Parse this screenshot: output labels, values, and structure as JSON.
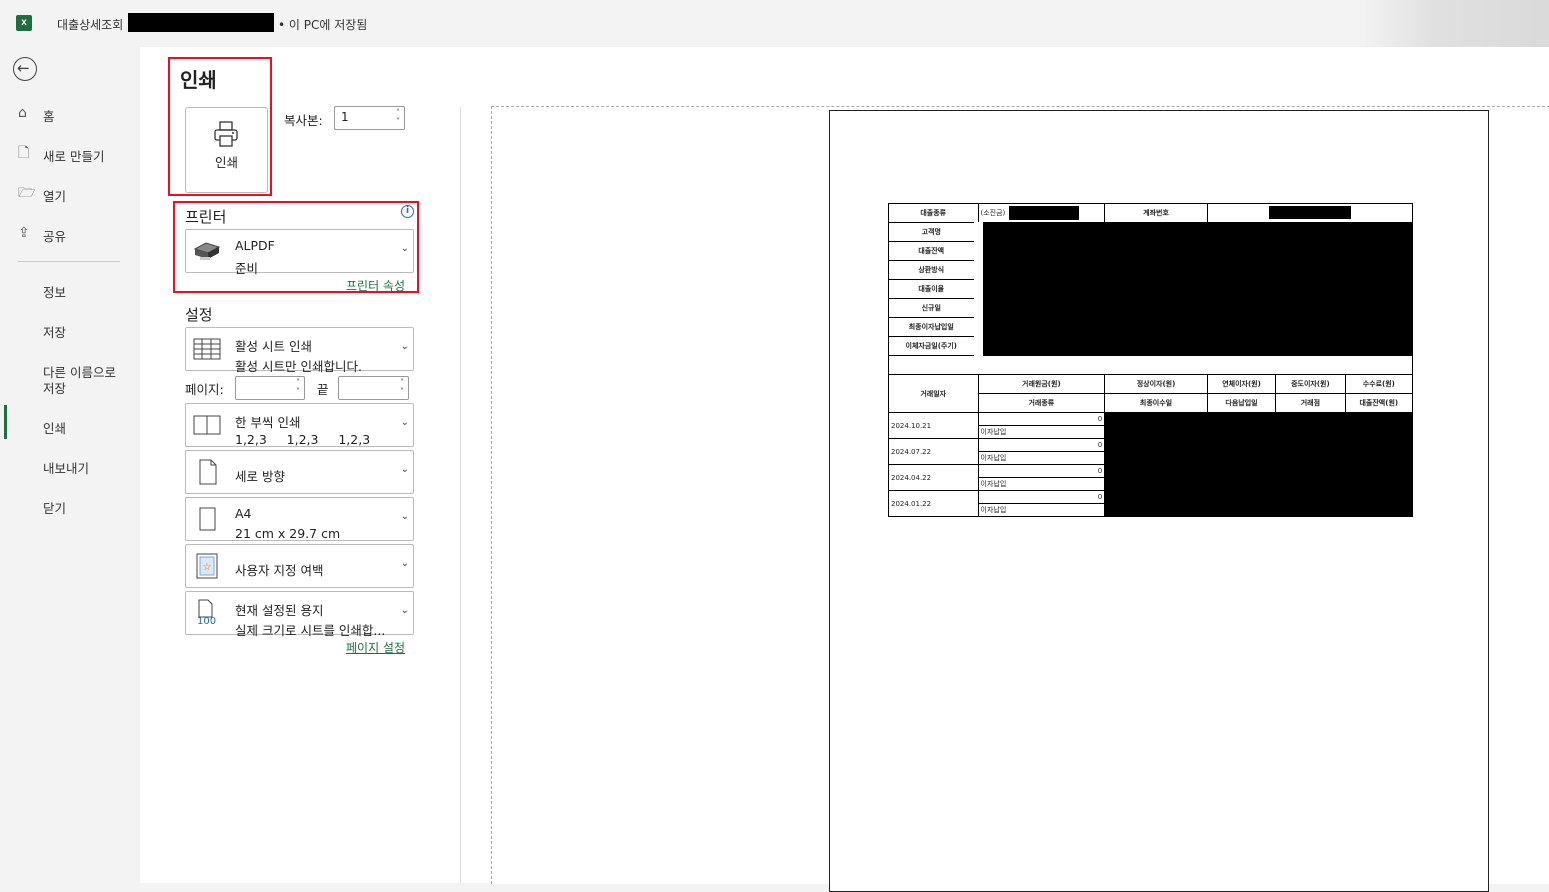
{
  "titlebar": {
    "doc_title": "대출상세조회",
    "save_status": "• 이 PC에 저장됨"
  },
  "sidebar": {
    "top": [
      {
        "label": "홈",
        "icon": "home-icon"
      },
      {
        "label": "새로 만들기",
        "icon": "new-file-icon"
      },
      {
        "label": "열기",
        "icon": "folder-open-icon"
      },
      {
        "label": "공유",
        "icon": "share-icon"
      }
    ],
    "bottom": [
      {
        "label": "정보"
      },
      {
        "label": "저장"
      },
      {
        "label": "다른 이름으로\n저장",
        "line1": "다른 이름으로",
        "line2": "저장"
      },
      {
        "label": "인쇄"
      },
      {
        "label": "내보내기"
      },
      {
        "label": "닫기"
      }
    ]
  },
  "print": {
    "title": "인쇄",
    "button_label": "인쇄",
    "copies_label": "복사본:",
    "copies_value": "1"
  },
  "printer": {
    "title": "프린터",
    "name": "ALPDF",
    "status": "준비",
    "properties_link": "프린터 속성"
  },
  "settings": {
    "title": "설정",
    "scope": {
      "line1": "활성 시트 인쇄",
      "line2": "활성 시트만 인쇄합니다."
    },
    "pages_label": "페이지:",
    "to_label": "끝",
    "collate": {
      "line1": "한 부씩 인쇄",
      "line2": "1,2,3     1,2,3     1,2,3"
    },
    "orientation": "세로 방향",
    "paper": {
      "line1": "A4",
      "line2": "21 cm x 29.7 cm"
    },
    "margins": "사용자 지정 여백",
    "scaling": {
      "line1": "현재 설정된 용지",
      "line2": "실제 크기로 시트를 인쇄합...",
      "icon_text": "100"
    },
    "page_setup_link": "페이지 설정"
  },
  "preview": {
    "rows_top": [
      {
        "label": "대출종류",
        "value": "(소진금)"
      },
      {
        "label": "고객명"
      },
      {
        "label": "대출잔액"
      },
      {
        "label": "상환방식"
      },
      {
        "label": "대출이율"
      },
      {
        "label": "신규일"
      },
      {
        "label": "최종이자납입일"
      },
      {
        "label": "이체자금일(주기)"
      }
    ],
    "account_label": "계좌번호",
    "tx_header_date": "거래일자",
    "tx_headers_1": [
      "거래원금(원)",
      "정상이자(원)",
      "연체이자(원)",
      "중도이자(원)",
      "수수료(원)"
    ],
    "tx_headers_2": [
      "거래종류",
      "최종이수일",
      "다음납입일",
      "거래점",
      "대출잔액(원)"
    ],
    "transactions": [
      {
        "date": "2024.10.21",
        "amount": "0",
        "type": "이자납입"
      },
      {
        "date": "2024.07.22",
        "amount": "0",
        "type": "이자납입"
      },
      {
        "date": "2024.04.22",
        "amount": "0",
        "type": "이자납입"
      },
      {
        "date": "2024.01.22",
        "amount": "0",
        "type": "이자납입"
      }
    ]
  }
}
